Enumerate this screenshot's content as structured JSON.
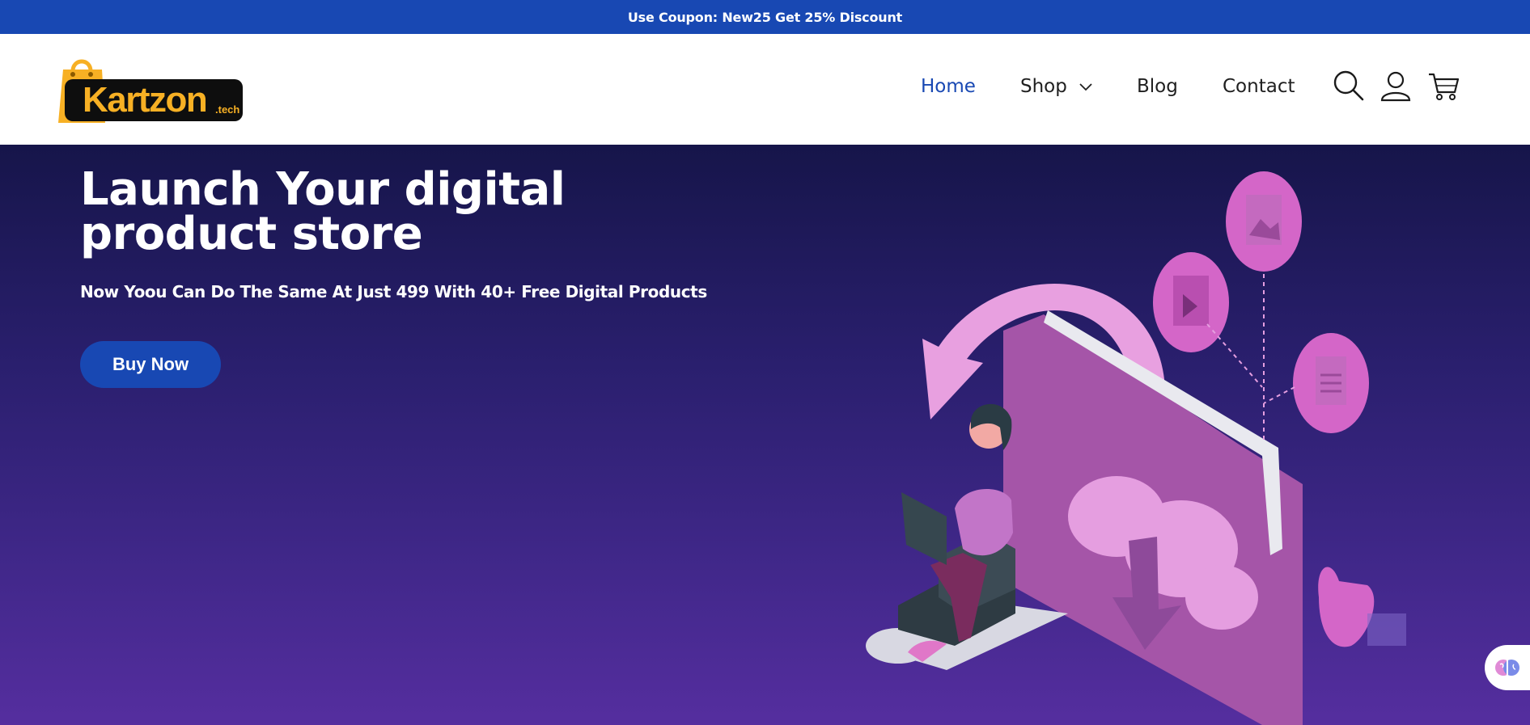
{
  "announcement": {
    "text": "Use Coupon: New25 Get 25% Discount"
  },
  "logo": {
    "name": "Kartzon",
    "tld": ".tech"
  },
  "nav": {
    "items": [
      {
        "label": "Home",
        "active": true
      },
      {
        "label": "Shop",
        "has_dropdown": true
      },
      {
        "label": "Blog"
      },
      {
        "label": "Contact"
      }
    ],
    "icons": [
      "search-icon",
      "user-icon",
      "cart-icon"
    ]
  },
  "hero": {
    "title": "Launch Your digital product store",
    "subtitle": "Now Yoou Can Do The Same  At Just 499 With 40+ Free Digital Products",
    "cta_label": "Buy Now"
  },
  "colors": {
    "brand_blue": "#1848b3",
    "logo_yellow": "#f7b024",
    "hero_top": "#16154a",
    "hero_bottom": "#552e9f",
    "illustration_pink": "#d466c8"
  }
}
